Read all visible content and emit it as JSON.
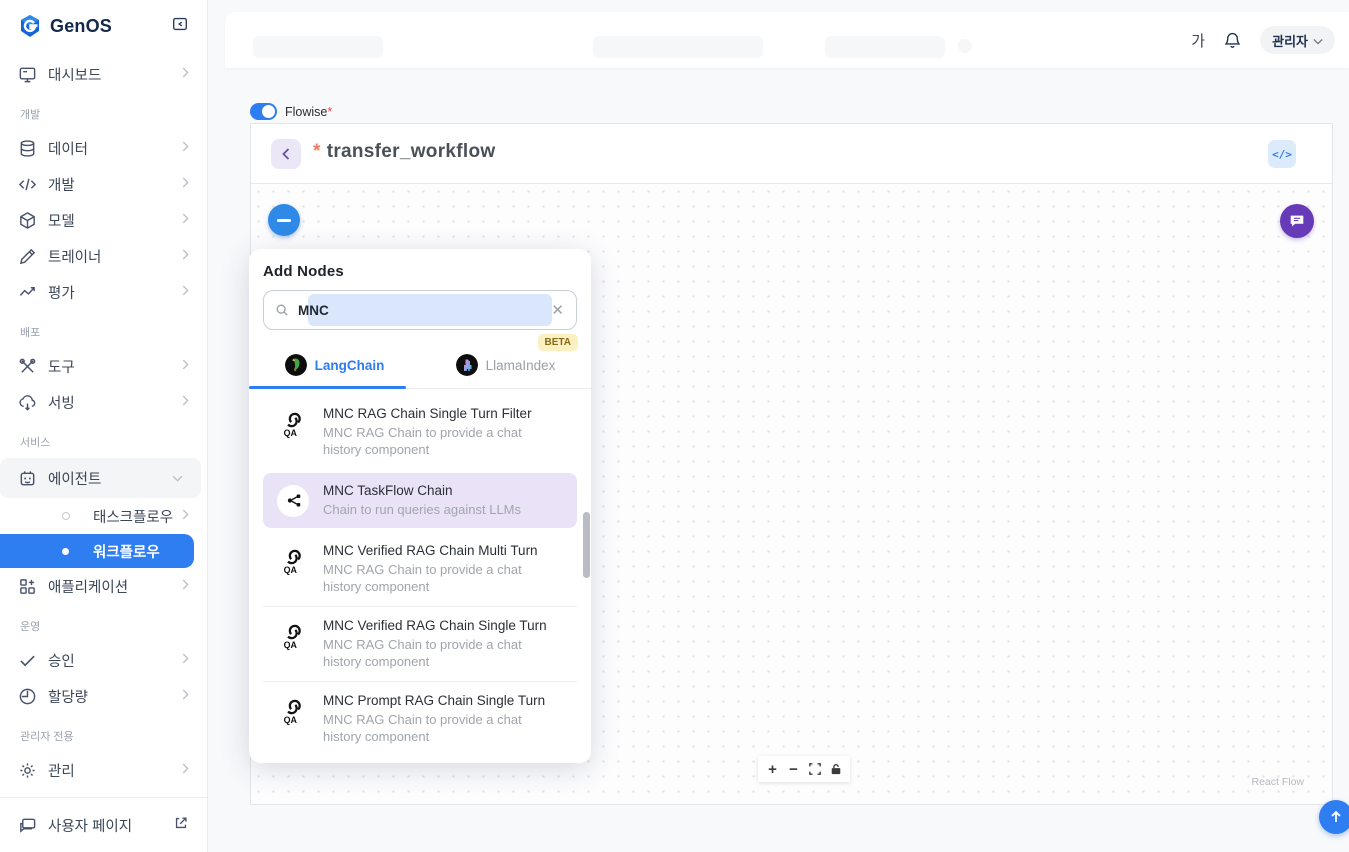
{
  "sidebar": {
    "logo": "GenOS",
    "dashboard": {
      "label": "대시보드"
    },
    "sections": [
      {
        "label": "개발",
        "items": [
          {
            "label": "데이터"
          },
          {
            "label": "개발"
          },
          {
            "label": "모델"
          },
          {
            "label": "트레이너"
          },
          {
            "label": "평가"
          }
        ]
      },
      {
        "label": "배포",
        "items": [
          {
            "label": "도구"
          },
          {
            "label": "서빙"
          }
        ]
      },
      {
        "label": "서비스",
        "items": [
          {
            "label": "에이전트"
          },
          {
            "label": "태스크플로우"
          },
          {
            "label": "워크플로우"
          },
          {
            "label": "애플리케이션"
          }
        ]
      },
      {
        "label": "운영",
        "items": [
          {
            "label": "승인"
          },
          {
            "label": "할당량"
          }
        ]
      },
      {
        "label": "관리자 전용",
        "items": [
          {
            "label": "관리"
          }
        ]
      }
    ],
    "footer": {
      "label": "사용자 페이지"
    }
  },
  "header": {
    "font_button": "가",
    "profile": "관리자"
  },
  "workspace": {
    "flowise_label": "Flowise",
    "flowise_required": "*",
    "title_asterisk": "*",
    "title": "transfer_workflow",
    "code_button": "</>"
  },
  "add_nodes": {
    "title": "Add Nodes",
    "search_value": "MNC",
    "tabs": [
      {
        "label": "LangChain"
      },
      {
        "label": "LlamaIndex",
        "badge": "BETA"
      }
    ],
    "items": [
      {
        "icon": "qa-chain-icon",
        "title": "MNC RAG Chain Single Turn Filter",
        "desc": "MNC RAG Chain to provide a chat history component"
      },
      {
        "icon": "taskflow-icon",
        "title": "MNC TaskFlow Chain",
        "desc": "Chain to run queries against LLMs",
        "highlighted": true
      },
      {
        "icon": "qa-chain-icon",
        "title": "MNC Verified RAG Chain Multi Turn",
        "desc": "MNC RAG Chain to provide a chat history component"
      },
      {
        "icon": "qa-chain-icon",
        "title": "MNC Verified RAG Chain Single Turn",
        "desc": "MNC RAG Chain to provide a chat history component"
      },
      {
        "icon": "qa-chain-icon",
        "title": "MNC Prompt RAG Chain Single Turn",
        "desc": "MNC RAG Chain to provide a chat history component"
      }
    ]
  },
  "canvas": {
    "zoom_in": "+",
    "zoom_out": "−",
    "attribution": "React Flow"
  },
  "colors": {
    "accent_blue": "#2e7df1",
    "active_purple": "#673ab7",
    "highlight_purple": "#eae3f7",
    "beta_bg": "#fbf0c2",
    "required_red": "#e5484d"
  }
}
